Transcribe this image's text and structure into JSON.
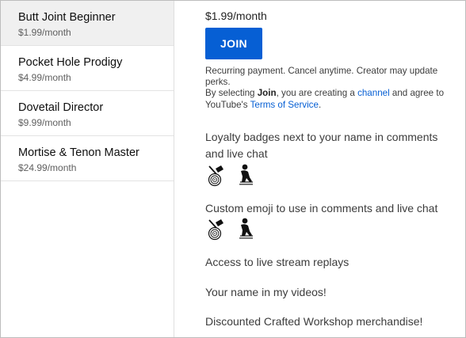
{
  "tiers": [
    {
      "name": "Butt Joint Beginner",
      "price": "$1.99/month"
    },
    {
      "name": "Pocket Hole Prodigy",
      "price": "$4.99/month"
    },
    {
      "name": "Dovetail Director",
      "price": "$9.99/month"
    },
    {
      "name": "Mortise & Tenon Master",
      "price": "$24.99/month"
    }
  ],
  "main": {
    "price": "$1.99/month",
    "join_label": "JOIN",
    "fine_print": {
      "line1": "Recurring payment. Cancel anytime. Creator may update perks.",
      "by_selecting": "By selecting ",
      "join_word": "Join",
      "creating_a": ", you are creating a ",
      "channel_link": "channel",
      "agree_to": " and agree to YouTube's ",
      "tos_link": "Terms of Service",
      "period": "."
    },
    "perks": {
      "loyalty_badges": "Loyalty badges next to your name in comments and live chat",
      "custom_emoji": "Custom emoji to use in comments and live chat",
      "replays": "Access to live stream replays",
      "name_in_videos": "Your name in my videos!",
      "merch": "Discounted Crafted Workshop merchandise!"
    }
  },
  "colors": {
    "accent": "#065fd4",
    "selected_bg": "#f0f0f0"
  },
  "icons": [
    "axe-log-badge-icon",
    "crouching-figure-badge-icon"
  ]
}
